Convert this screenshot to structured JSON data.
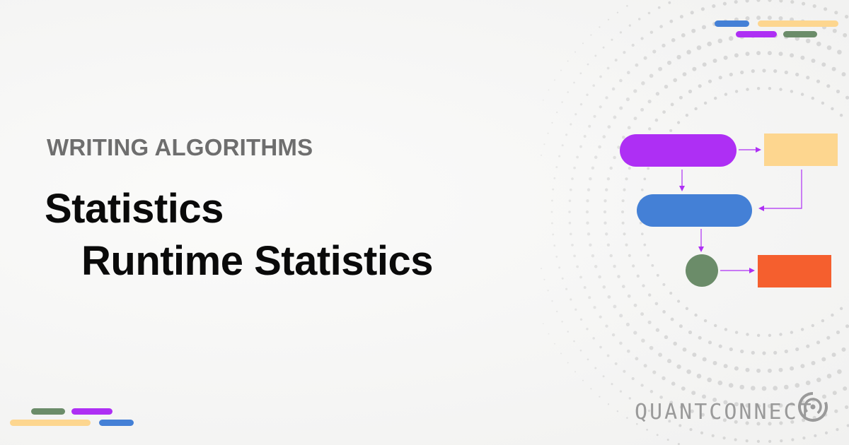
{
  "header": {
    "eyebrow": "WRITING ALGORITHMS",
    "title_line1": "Statistics",
    "title_line2": "Runtime Statistics"
  },
  "brand": {
    "name": "QUANTCONNECT",
    "logo_icon": "quantconnect-logo-icon"
  },
  "colors": {
    "purple": "#ae2ff4",
    "yellow": "#fdd68f",
    "blue": "#4480d6",
    "green": "#6b8c69",
    "orange": "#f55f2e",
    "dots": "#cfcfcf"
  }
}
